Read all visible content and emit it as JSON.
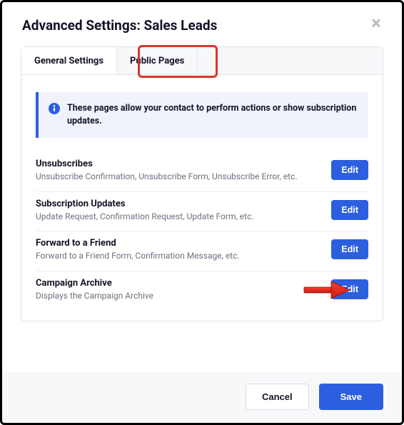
{
  "modal": {
    "title": "Advanced Settings: Sales Leads"
  },
  "tabs": {
    "general": "General Settings",
    "public": "Public Pages"
  },
  "info_banner": "These pages allow your contact to perform actions or show subscription updates.",
  "rows": [
    {
      "title": "Unsubscribes",
      "desc": "Unsubscribe Confirmation, Unsubscribe Form, Unsubscribe Error, etc.",
      "btn": "Edit"
    },
    {
      "title": "Subscription Updates",
      "desc": "Update Request, Confirmation Request, Update Form, etc.",
      "btn": "Edit"
    },
    {
      "title": "Forward to a Friend",
      "desc": "Forward to a Friend Form, Confirmation Message, etc.",
      "btn": "Edit"
    },
    {
      "title": "Campaign Archive",
      "desc": "Displays the Campaign Archive",
      "btn": "Edit"
    }
  ],
  "footer": {
    "cancel": "Cancel",
    "save": "Save"
  }
}
